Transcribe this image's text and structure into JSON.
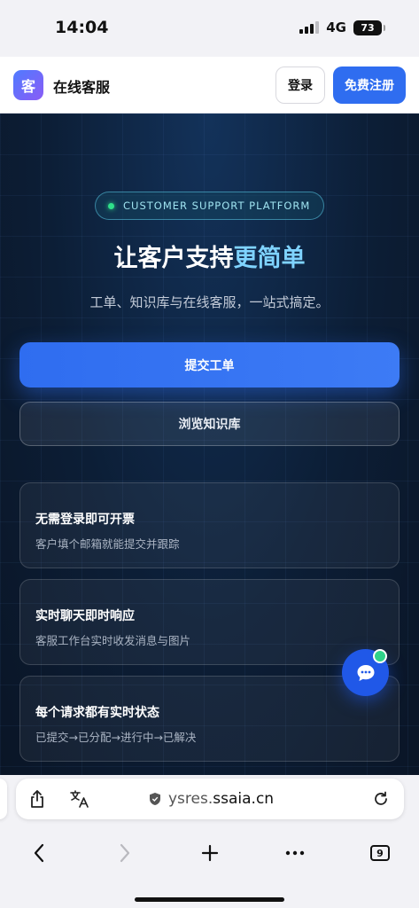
{
  "status_bar": {
    "time": "14:04",
    "network": "4G",
    "battery": "73"
  },
  "header": {
    "logo_text": "客",
    "brand": "在线客服",
    "login_label": "登录",
    "register_label": "免费注册"
  },
  "hero": {
    "badge": "CUSTOMER SUPPORT PLATFORM",
    "title_main": "让客户支持",
    "title_highlight": "更简单",
    "subtitle": "工单、知识库与在线客服，一站式搞定。",
    "primary_button": "提交工单",
    "secondary_button": "浏览知识库"
  },
  "features": [
    {
      "title": "无需登录即可开票",
      "desc": "客户填个邮箱就能提交并跟踪"
    },
    {
      "title": "实时聊天即时响应",
      "desc": "客服工作台实时收发消息与图片"
    },
    {
      "title": "每个请求都有实时状态",
      "desc": "已提交→已分配→进行中→已解决"
    }
  ],
  "browser": {
    "url_prefix": "ysres.",
    "url_domain": "ssaia.cn",
    "tab_count": "9"
  },
  "colors": {
    "accent": "#2f6df0",
    "highlight": "#7fd3ff",
    "hero_bg": "#0c1e36",
    "online": "#2fd38a"
  },
  "icons": [
    "signal-icon",
    "battery-icon",
    "chat-icon",
    "share-icon",
    "translate-icon",
    "shield-icon",
    "reload-icon",
    "back-icon",
    "forward-icon",
    "plus-icon",
    "more-icon",
    "tabs-icon"
  ]
}
